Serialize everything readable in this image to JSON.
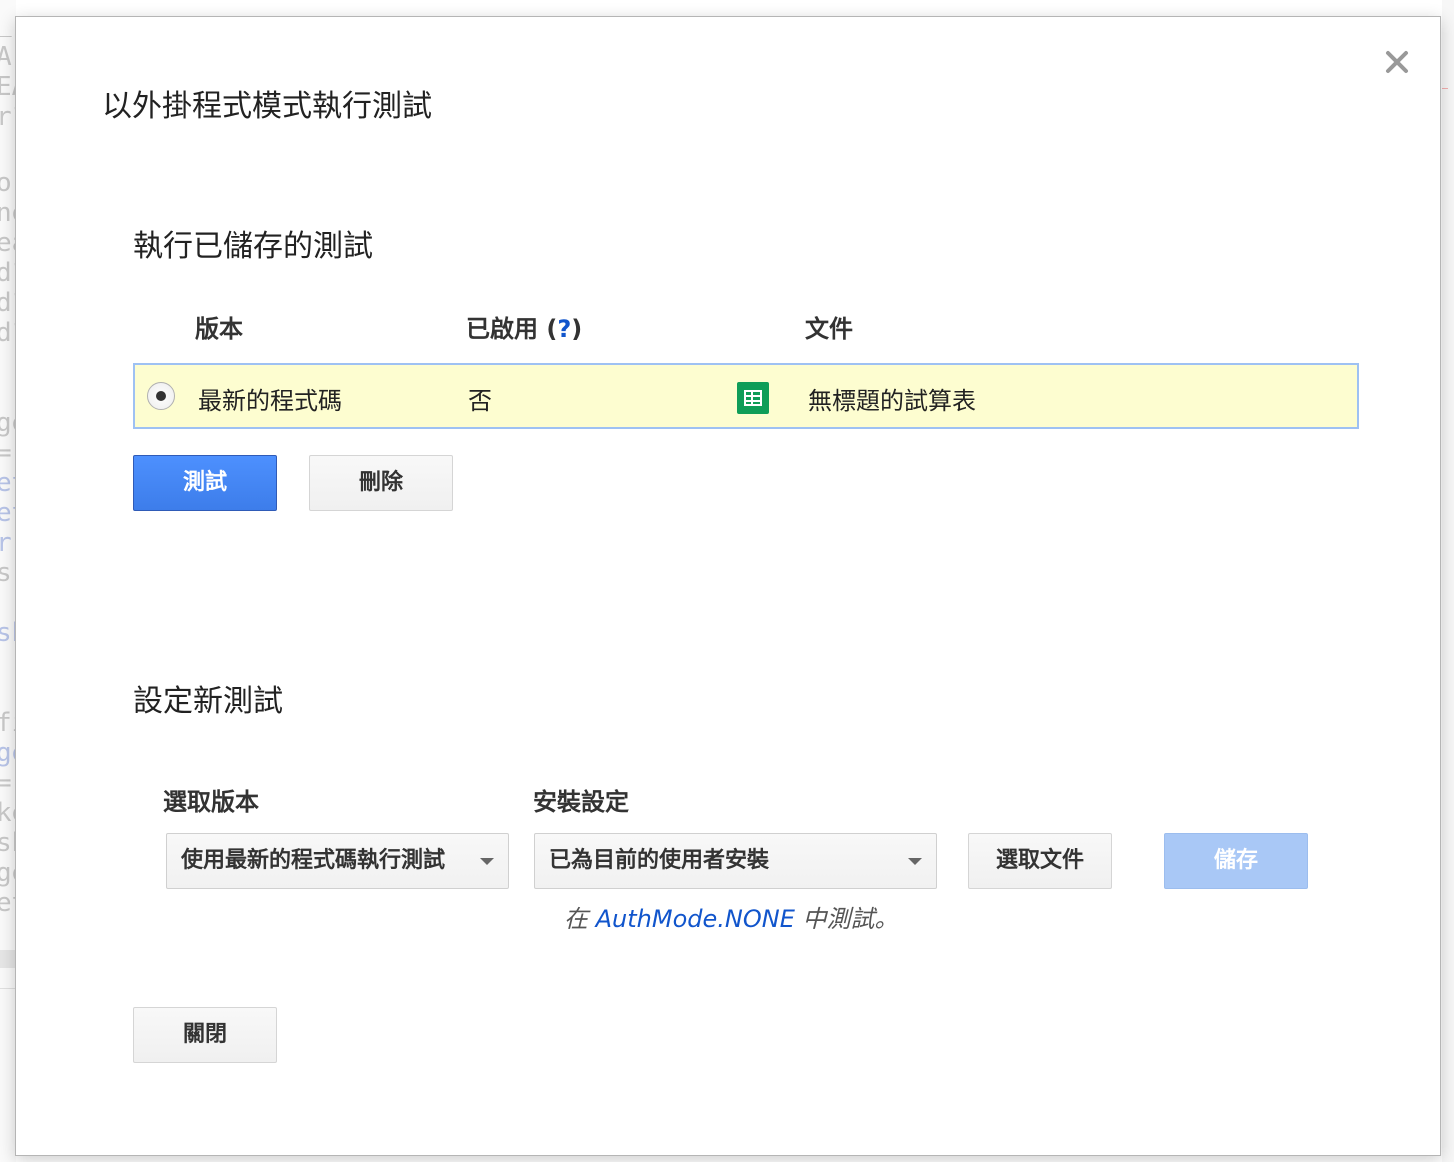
{
  "dialog": {
    "title": "以外掛程式模式執行測試",
    "close_icon": "close-icon"
  },
  "saved_tests": {
    "section_title": "執行已儲存的測試",
    "columns": {
      "version": "版本",
      "enabled": "已啟用",
      "help": "?",
      "document": "文件"
    },
    "rows": [
      {
        "selected": true,
        "version": "最新的程式碼",
        "enabled": "否",
        "document_icon": "sheets-icon",
        "document": "無標題的試算表"
      }
    ],
    "test_button": "測試",
    "delete_button": "刪除"
  },
  "new_test": {
    "section_title": "設定新測試",
    "version_label": "選取版本",
    "version_value": "使用最新的程式碼執行測試",
    "install_label": "安裝設定",
    "install_value": "已為目前的使用者安裝",
    "choose_document_button": "選取文件",
    "save_button": "儲存",
    "auth_note_prefix": "在",
    "auth_mode": "AuthMode.NONE",
    "auth_note_suffix": "中測試。"
  },
  "close_button": "關閉",
  "colors": {
    "primary_blue": "#4d90fe",
    "row_highlight": "#fdfdd0",
    "row_border": "#9ec1f3",
    "sheets_green": "#0f9d58",
    "link_blue": "#1155cc"
  }
}
